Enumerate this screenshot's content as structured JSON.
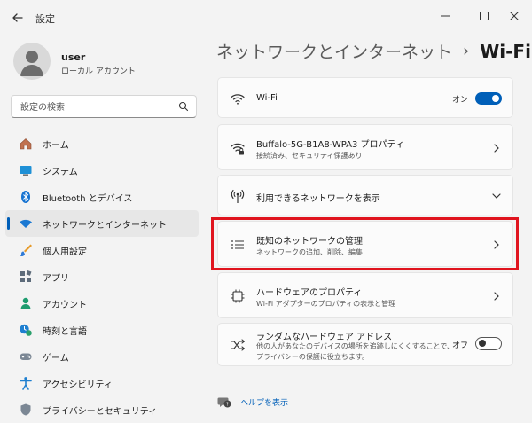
{
  "window": {
    "title": "設定",
    "controls": [
      "minimize",
      "maximize",
      "close"
    ]
  },
  "user": {
    "name": "user",
    "account_type": "ローカル アカウント"
  },
  "search": {
    "placeholder": "設定の検索"
  },
  "sidebar": {
    "items": [
      {
        "label": "ホーム",
        "icon": "home-icon"
      },
      {
        "label": "システム",
        "icon": "system-icon"
      },
      {
        "label": "Bluetooth とデバイス",
        "icon": "bluetooth-icon"
      },
      {
        "label": "ネットワークとインターネット",
        "icon": "wifi-icon",
        "active": true
      },
      {
        "label": "個人用設定",
        "icon": "brush-icon"
      },
      {
        "label": "アプリ",
        "icon": "apps-icon"
      },
      {
        "label": "アカウント",
        "icon": "account-icon"
      },
      {
        "label": "時刻と言語",
        "icon": "clock-globe-icon"
      },
      {
        "label": "ゲーム",
        "icon": "gamepad-icon"
      },
      {
        "label": "アクセシビリティ",
        "icon": "accessibility-icon"
      },
      {
        "label": "プライバシーとセキュリティ",
        "icon": "shield-icon"
      }
    ]
  },
  "breadcrumb": {
    "parent": "ネットワークとインターネット",
    "separator": "›",
    "current": "Wi-Fi"
  },
  "cards": [
    {
      "title": "Wi-Fi",
      "icon": "wifi-icon",
      "toggle_label": "オン",
      "toggle_state": "on"
    },
    {
      "title": "Buffalo-5G-B1A8-WPA3 プロパティ",
      "subtitle": "接続済み、セキュリティ保護あり",
      "icon": "wifi-lock-icon"
    },
    {
      "title": "利用できるネットワークを表示",
      "icon": "antenna-icon"
    },
    {
      "title": "既知のネットワークの管理",
      "subtitle": "ネットワークの追加、削除、編集",
      "icon": "list-icon"
    },
    {
      "title": "ハードウェアのプロパティ",
      "subtitle": "Wi-Fi アダプターのプロパティの表示と管理",
      "icon": "chip-icon"
    },
    {
      "title": "ランダムなハードウェア アドレス",
      "subtitle_line1": "他の人があなたのデバイスの場所を追跡しにくくすることで、",
      "subtitle_line2": "プライバシーの保護に役立ちます。",
      "icon": "shuffle-icon",
      "toggle_label": "オフ",
      "toggle_state": "off"
    }
  ],
  "help": {
    "label": "ヘルプを表示"
  },
  "colors": {
    "accent": "#005fb8",
    "highlight": "#e0141e",
    "background": "#f3f3f3"
  }
}
